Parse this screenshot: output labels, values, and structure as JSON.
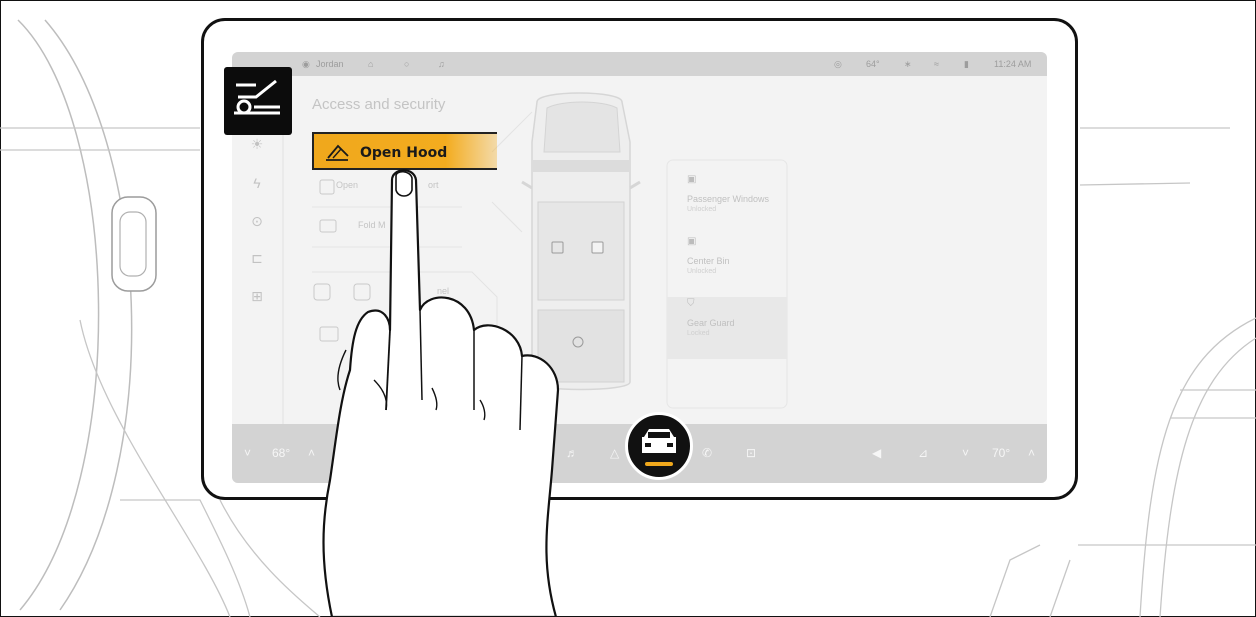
{
  "status": {
    "user": "Jordan",
    "temp_outside": "64°",
    "time": "11:24 AM"
  },
  "screen": {
    "title": "Access and security",
    "open_hood_label": "Open Hood",
    "list_item_1": "Open ",
    "list_item_1_tail": "ort",
    "list_item_2": "Fold M",
    "list_item_3_tail": "nel"
  },
  "cards": [
    {
      "title": "Passenger Windows",
      "status": "Unlocked"
    },
    {
      "title": "Center Bin",
      "status": "Unlocked"
    },
    {
      "title": "Gear Guard",
      "status": "Locked"
    }
  ],
  "bottom": {
    "left_temp": "68°",
    "right_temp": "70°"
  },
  "colors": {
    "accent": "#f0a81c",
    "selected_indicator": "#f0a81c"
  },
  "icons": {
    "top_left_tile": "open-hood-icon",
    "selected_nav": "vehicle-icon"
  }
}
